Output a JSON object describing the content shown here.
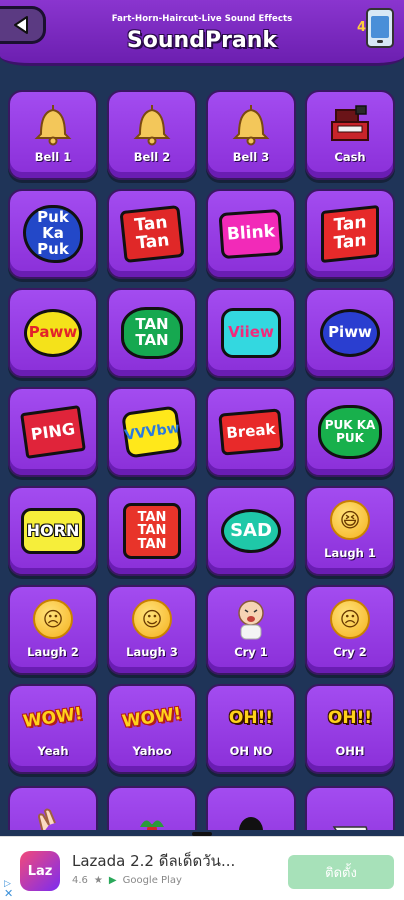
{
  "header": {
    "subtitle": "Fart-Horn-Haircut-Live Sound Effects",
    "title": "SoundPrank",
    "badge_count": "4",
    "back_icon": "back-arrow-icon",
    "phone_icon": "phone-icon"
  },
  "tiles": [
    {
      "label": "Bell 1",
      "art": "bell-icon"
    },
    {
      "label": "Bell 2",
      "art": "bell-icon"
    },
    {
      "label": "Bell 3",
      "art": "bell-icon"
    },
    {
      "label": "Cash",
      "art": "cash-register-icon"
    },
    {
      "art_text": "Puk Ka Puk"
    },
    {
      "art_text": "Tan Tan"
    },
    {
      "art_text": "Blink"
    },
    {
      "art_text": "Tan Tan"
    },
    {
      "art_text": "Paww"
    },
    {
      "art_text": "TAN TAN"
    },
    {
      "art_text": "Viiew"
    },
    {
      "art_text": "Piww"
    },
    {
      "art_text": "PING"
    },
    {
      "art_text": "VVVbw"
    },
    {
      "art_text": "Break"
    },
    {
      "art_text": "PUK KA PUK"
    },
    {
      "art_text": "HORN"
    },
    {
      "art_text": "TAN TAN TAN"
    },
    {
      "art_text": "SAD"
    },
    {
      "label": "Laugh 1",
      "art": "laughing-face-icon"
    },
    {
      "label": "Laugh 2",
      "art": "laughing-face-icon"
    },
    {
      "label": "Laugh 3",
      "art": "laughing-face-icon"
    },
    {
      "label": "Cry 1",
      "art": "crying-baby-icon"
    },
    {
      "label": "Cry 2",
      "art": "crying-face-icon"
    },
    {
      "label": "Yeah",
      "art_text": "WOW!"
    },
    {
      "label": "Yahoo",
      "art_text": "WOW!"
    },
    {
      "label": "OH NO",
      "art_text": "OH!!"
    },
    {
      "label": "OHH",
      "art_text": "OH!!"
    }
  ],
  "ad": {
    "logo_text": "Laz",
    "title": "Lazada 2.2 ดีลเด็ดวัน...",
    "rating": "4.6",
    "store": "Google Play",
    "cta": "ติดตั้ง",
    "info_icon": "info-icon",
    "close_icon": "close-icon"
  },
  "colors": {
    "background": "#1f3458",
    "header": "#7a2bc2",
    "tile": "#9a40e8",
    "ad_button": "#a7e1b9"
  }
}
